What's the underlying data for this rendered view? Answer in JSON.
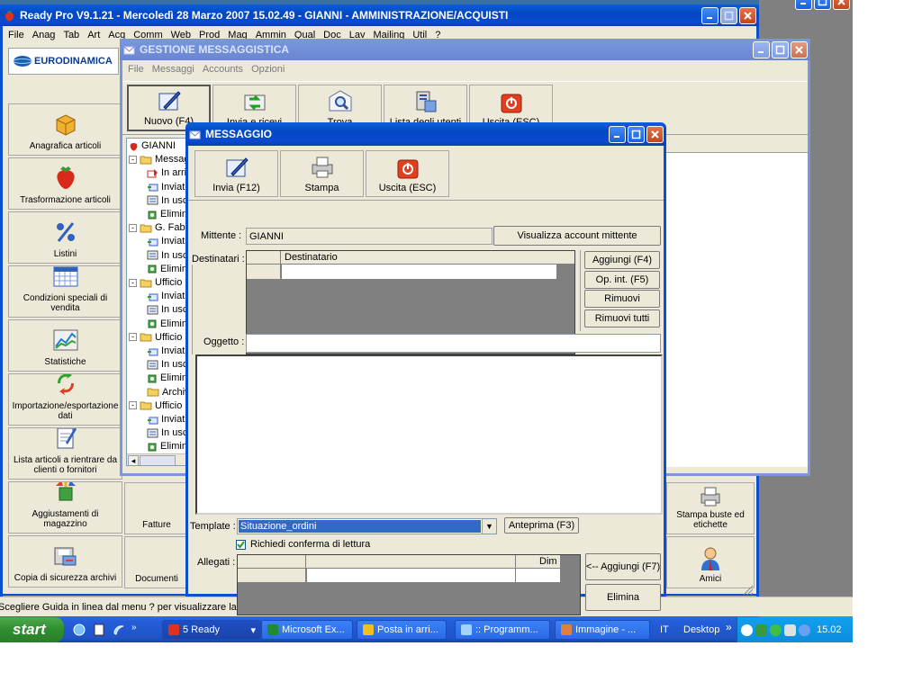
{
  "colors": {
    "accent": "#0a50cf",
    "desktop": "#3a6ea5",
    "window_face": "#ece9d8",
    "selection": "#316ac5",
    "start_green": "#3c9a3c"
  },
  "main_window": {
    "title": "Ready Pro V9.1.21 - Mercoledì 28 Marzo 2007  15.02.49 - GIANNI - AMMINISTRAZIONE/ACQUISTI",
    "menu": [
      "File",
      "Anag",
      "Tab",
      "Art",
      "Acq",
      "Comm",
      "Web",
      "Prod",
      "Mag",
      "Ammin",
      "Qual",
      "Doc",
      "Lav",
      "Mailing",
      "Util",
      "?"
    ],
    "logo_text": "EURODINAMICA",
    "sidebar": [
      {
        "label": "Anagrafica articoli",
        "icon": "box-icon"
      },
      {
        "label": "Trasformazione articoli",
        "icon": "strawberry-icon"
      },
      {
        "label": "Listini",
        "icon": "percent-icon"
      },
      {
        "label": "Condizioni speciali di vendita",
        "icon": "calendar-icon"
      },
      {
        "label": "Statistiche",
        "icon": "chart-icon"
      },
      {
        "label": "Importazione/esportazione dati",
        "icon": "arrows-icon"
      },
      {
        "label": "Lista articoli a rientrare da clienti o fornitori",
        "icon": "notepad-icon"
      },
      {
        "label": "Aggiustamenti di magazzino",
        "icon": "adjust-icon"
      },
      {
        "label": "Copia di sicurezza archivi",
        "icon": "backup-icon"
      }
    ],
    "mid_column": [
      "Fatture",
      "Documenti"
    ],
    "right_column": [
      {
        "label": "Stampa buste ed etichette",
        "icon": "printer-icon"
      },
      {
        "label": "Amici",
        "icon": "user-icon"
      }
    ],
    "status_text": "Scegliere Guida in linea dal menu ? per visualizzare la Guida di Pant."
  },
  "gestione": {
    "title": "GESTIONE MESSAGGISTICA",
    "menu": [
      "File",
      "Messaggi",
      "Accounts",
      "Opzioni"
    ],
    "toolbar": [
      "Nuovo (F4)",
      "Invia e ricevi",
      "Trova",
      "Lista degli utenti",
      "Uscita (ESC)"
    ],
    "tree": [
      {
        "label": "GIANNI",
        "indent": 0,
        "icon": "strawberry-icon",
        "exp": ""
      },
      {
        "label": "Messaggi",
        "indent": 1,
        "icon": "folder-icon",
        "exp": "-"
      },
      {
        "label": "In arrivo",
        "indent": 2,
        "icon": "inbox-icon",
        "exp": ""
      },
      {
        "label": "Inviati",
        "indent": 2,
        "icon": "send-icon",
        "exp": ""
      },
      {
        "label": "In uscita",
        "indent": 2,
        "icon": "outbox-icon",
        "exp": ""
      },
      {
        "label": "Eliminati",
        "indent": 2,
        "icon": "trash-icon",
        "exp": ""
      },
      {
        "label": "G. Fab",
        "indent": 0,
        "icon": "folder-icon",
        "exp": "-"
      },
      {
        "label": "Inviati",
        "indent": 2,
        "icon": "send-icon",
        "exp": ""
      },
      {
        "label": "In uscita",
        "indent": 2,
        "icon": "outbox-icon",
        "exp": ""
      },
      {
        "label": "Eliminati",
        "indent": 2,
        "icon": "trash-icon",
        "exp": ""
      },
      {
        "label": "Ufficio",
        "indent": 0,
        "icon": "folder-icon",
        "exp": "-"
      },
      {
        "label": "Inviati",
        "indent": 2,
        "icon": "send-icon",
        "exp": ""
      },
      {
        "label": "In uscita",
        "indent": 2,
        "icon": "outbox-icon",
        "exp": ""
      },
      {
        "label": "Eliminati",
        "indent": 2,
        "icon": "trash-icon",
        "exp": ""
      },
      {
        "label": "Ufficio",
        "indent": 0,
        "icon": "folder-icon",
        "exp": "-"
      },
      {
        "label": "Inviati",
        "indent": 2,
        "icon": "send-icon",
        "exp": ""
      },
      {
        "label": "In uscita",
        "indent": 2,
        "icon": "outbox-icon",
        "exp": ""
      },
      {
        "label": "Eliminati",
        "indent": 2,
        "icon": "trash-icon",
        "exp": ""
      },
      {
        "label": "Archivio",
        "indent": 2,
        "icon": "folder-icon",
        "exp": ""
      },
      {
        "label": "Ufficio",
        "indent": 0,
        "icon": "folder-icon",
        "exp": "-"
      },
      {
        "label": "Inviati",
        "indent": 2,
        "icon": "send-icon",
        "exp": ""
      },
      {
        "label": "In uscita",
        "indent": 2,
        "icon": "outbox-icon",
        "exp": ""
      },
      {
        "label": "Eliminati",
        "indent": 2,
        "icon": "trash-icon",
        "exp": ""
      }
    ]
  },
  "messaggio": {
    "title": "MESSAGGIO",
    "toolbar": {
      "send": "Invia (F12)",
      "print": "Stampa",
      "exit": "Uscita (ESC)"
    },
    "sender_label": "Mittente :",
    "sender_value": "GIANNI",
    "view_account": "Visualizza account mittente",
    "recipients_label": "Destinatari :",
    "recipients_col": "Destinatario",
    "add": "Aggiungi (F4)",
    "op_int": "Op. int. (F5)",
    "remove": "Rimuovi",
    "remove_all": "Rimuovi tutti",
    "subject_label": "Oggetto :",
    "subject_value": "",
    "template_label": "Template :",
    "template_value": "Situazione_ordini",
    "preview": "Anteprima (F3)",
    "read_receipt": "Richiedi conferma di lettura",
    "attachments_label": "Allegati :",
    "attachments_col_dim": "Dim",
    "add_attach": "<-- Aggiungi (F7)",
    "delete_attach": "Elimina"
  },
  "taskbar": {
    "start": "start",
    "items": [
      "5 Ready",
      "Microsoft Ex...",
      "Posta in arri...",
      ":: Programm...",
      "Immagine - ..."
    ],
    "lang": "IT",
    "desktop": "Desktop",
    "clock": "15.02"
  }
}
